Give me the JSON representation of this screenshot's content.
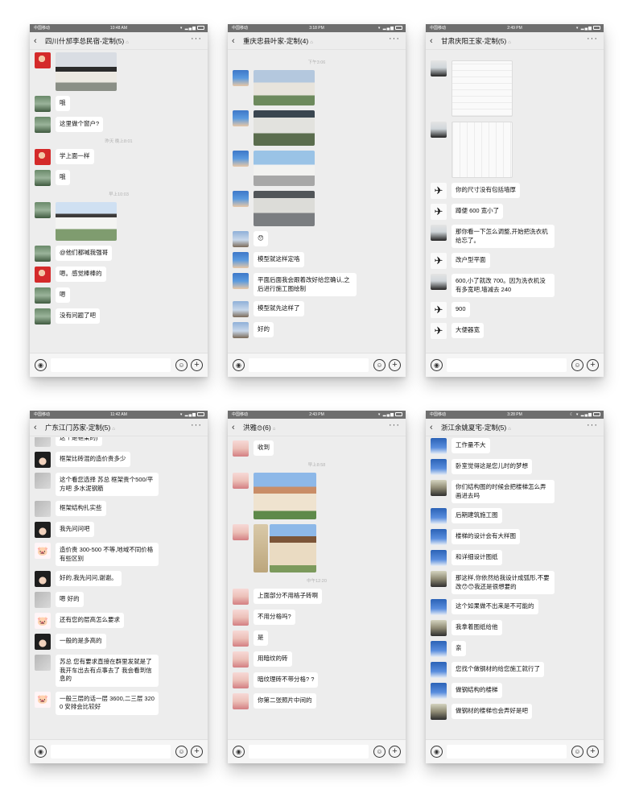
{
  "icons": {
    "back": "‹",
    "more": "···",
    "mute": "⌂",
    "voice": "◉",
    "emoji": "☺",
    "plus": "+",
    "pig": "🐷",
    "plane": "✈",
    "emoji_sticker": "😯"
  },
  "phones": [
    {
      "status": {
        "carrier": "中国移动",
        "time": "10:48 AM",
        "signal": "▾ ▂▄▆",
        "battery": "84"
      },
      "title": "四川什邡李总民宿-定制(5)",
      "messages": {
        "m1": "哦",
        "m2": "这里做个窗户?",
        "t1": "昨天 晚上8:01",
        "m3": "学上面一样",
        "m4": "哦",
        "t2": "早上10:03",
        "m5": "@他们都喊我强哥",
        "m6": "嗯。感觉棒棒的",
        "m7": "嗯",
        "m8": "没有问题了吧"
      }
    },
    {
      "status": {
        "carrier": "中国移动",
        "time": "3:18 PM",
        "signal": "▾ ▂▄▆",
        "battery": "59"
      },
      "title": "重庆忠县叶家-定制(4)",
      "messages": {
        "t1": "下午3:06",
        "m1": "模型就这样定咯",
        "m2": "平面后面我会跟着改好给您确认,之后进行施工图绘制",
        "m3": "模型就先这样了",
        "m4": "好的"
      }
    },
    {
      "status": {
        "carrier": "中国移动",
        "time": "2:49 PM",
        "signal": "▾ ▂▄▆",
        "battery": "52"
      },
      "title": "甘肃庆阳王家-定制(5)",
      "messages": {
        "m1": "你的尺寸没有包括墙厚",
        "m2": "蹲便 600 宽小了",
        "m3": "那你看一下怎么调整,开始把洗衣机给忘了。",
        "m4": "改户型平面",
        "m5": "600,小了就改 700。因为洗衣机没有多宽吧,墙减去 240",
        "m6": "900",
        "m7": "大便器宽"
      }
    },
    {
      "status": {
        "carrier": "中国移动",
        "time": "11:42 AM",
        "signal": "▾ ▂▄▆",
        "battery": "54"
      },
      "title": "广东江门苏家-定制(5)",
      "messages": {
        "m0": "这个是框架的)",
        "m1": "框架比砖混的造价贵多少",
        "m2": "这个看您选择 苏总 框架贵个500/平方吧 多水泥钢筋",
        "m3": "框架结构扎实些",
        "m4": "我先问问吧",
        "m5": "造价贵 300-500 不等,地域不同价格有些区别",
        "m6": "好的,我先问问,谢谢。",
        "m7": "嗯 好的",
        "m8": "还有您的层高怎么要求",
        "m9": "一般的是多高的",
        "m10": "苏总 您有要求直接在群里发就是了 我开车出去有点事去了 我会看到信息的",
        "m11": "一般三层的话一层 3600,二三层 3200 安排会比较好"
      }
    },
    {
      "status": {
        "carrier": "中国移动",
        "time": "2:43 PM",
        "signal": "▾ ▂▄▆",
        "battery": "53"
      },
      "title": "洪雅",
      "title_count": "(6)",
      "messages": {
        "m1": "收到",
        "t1": "早上8:58",
        "t2": "中午12:20",
        "m2": "上面部分不用格子砖啊",
        "m3": "不用分格吗?",
        "m4": "是",
        "m5": "用暗纹的砖",
        "m6": "暗纹理砖不带分格? ?",
        "m7": "你第二张照片中间的"
      }
    },
    {
      "status": {
        "carrier": "中国移动",
        "time": "3:28 PM",
        "signal": "☾ ▾ ▂▄▆",
        "battery": "48"
      },
      "title": "浙江余姚夏宅-定制(5)",
      "messages": {
        "m1": "工作量不大",
        "m2": "卧室觉得这是您儿时的梦想",
        "m3": "你们结构图的时候会把楼梯怎么弄画进去吗",
        "m4": "后期建筑施工图",
        "m5": "楼梯的设计会有大样图",
        "m6": "和详细设计图纸",
        "m7a": "那这样,你依然给我设计成弧形,不要改",
        "m7b": "我还是很想要的",
        "m8": "这个如果做不出来是不可能的",
        "m9": "我拿着图纸给他",
        "m10": "亲",
        "m11": "您找个做钢材的给您施工就行了",
        "m12": "做钢结构的楼梯",
        "m13": "做钢材的楼梯也会弄好是吧"
      }
    }
  ]
}
